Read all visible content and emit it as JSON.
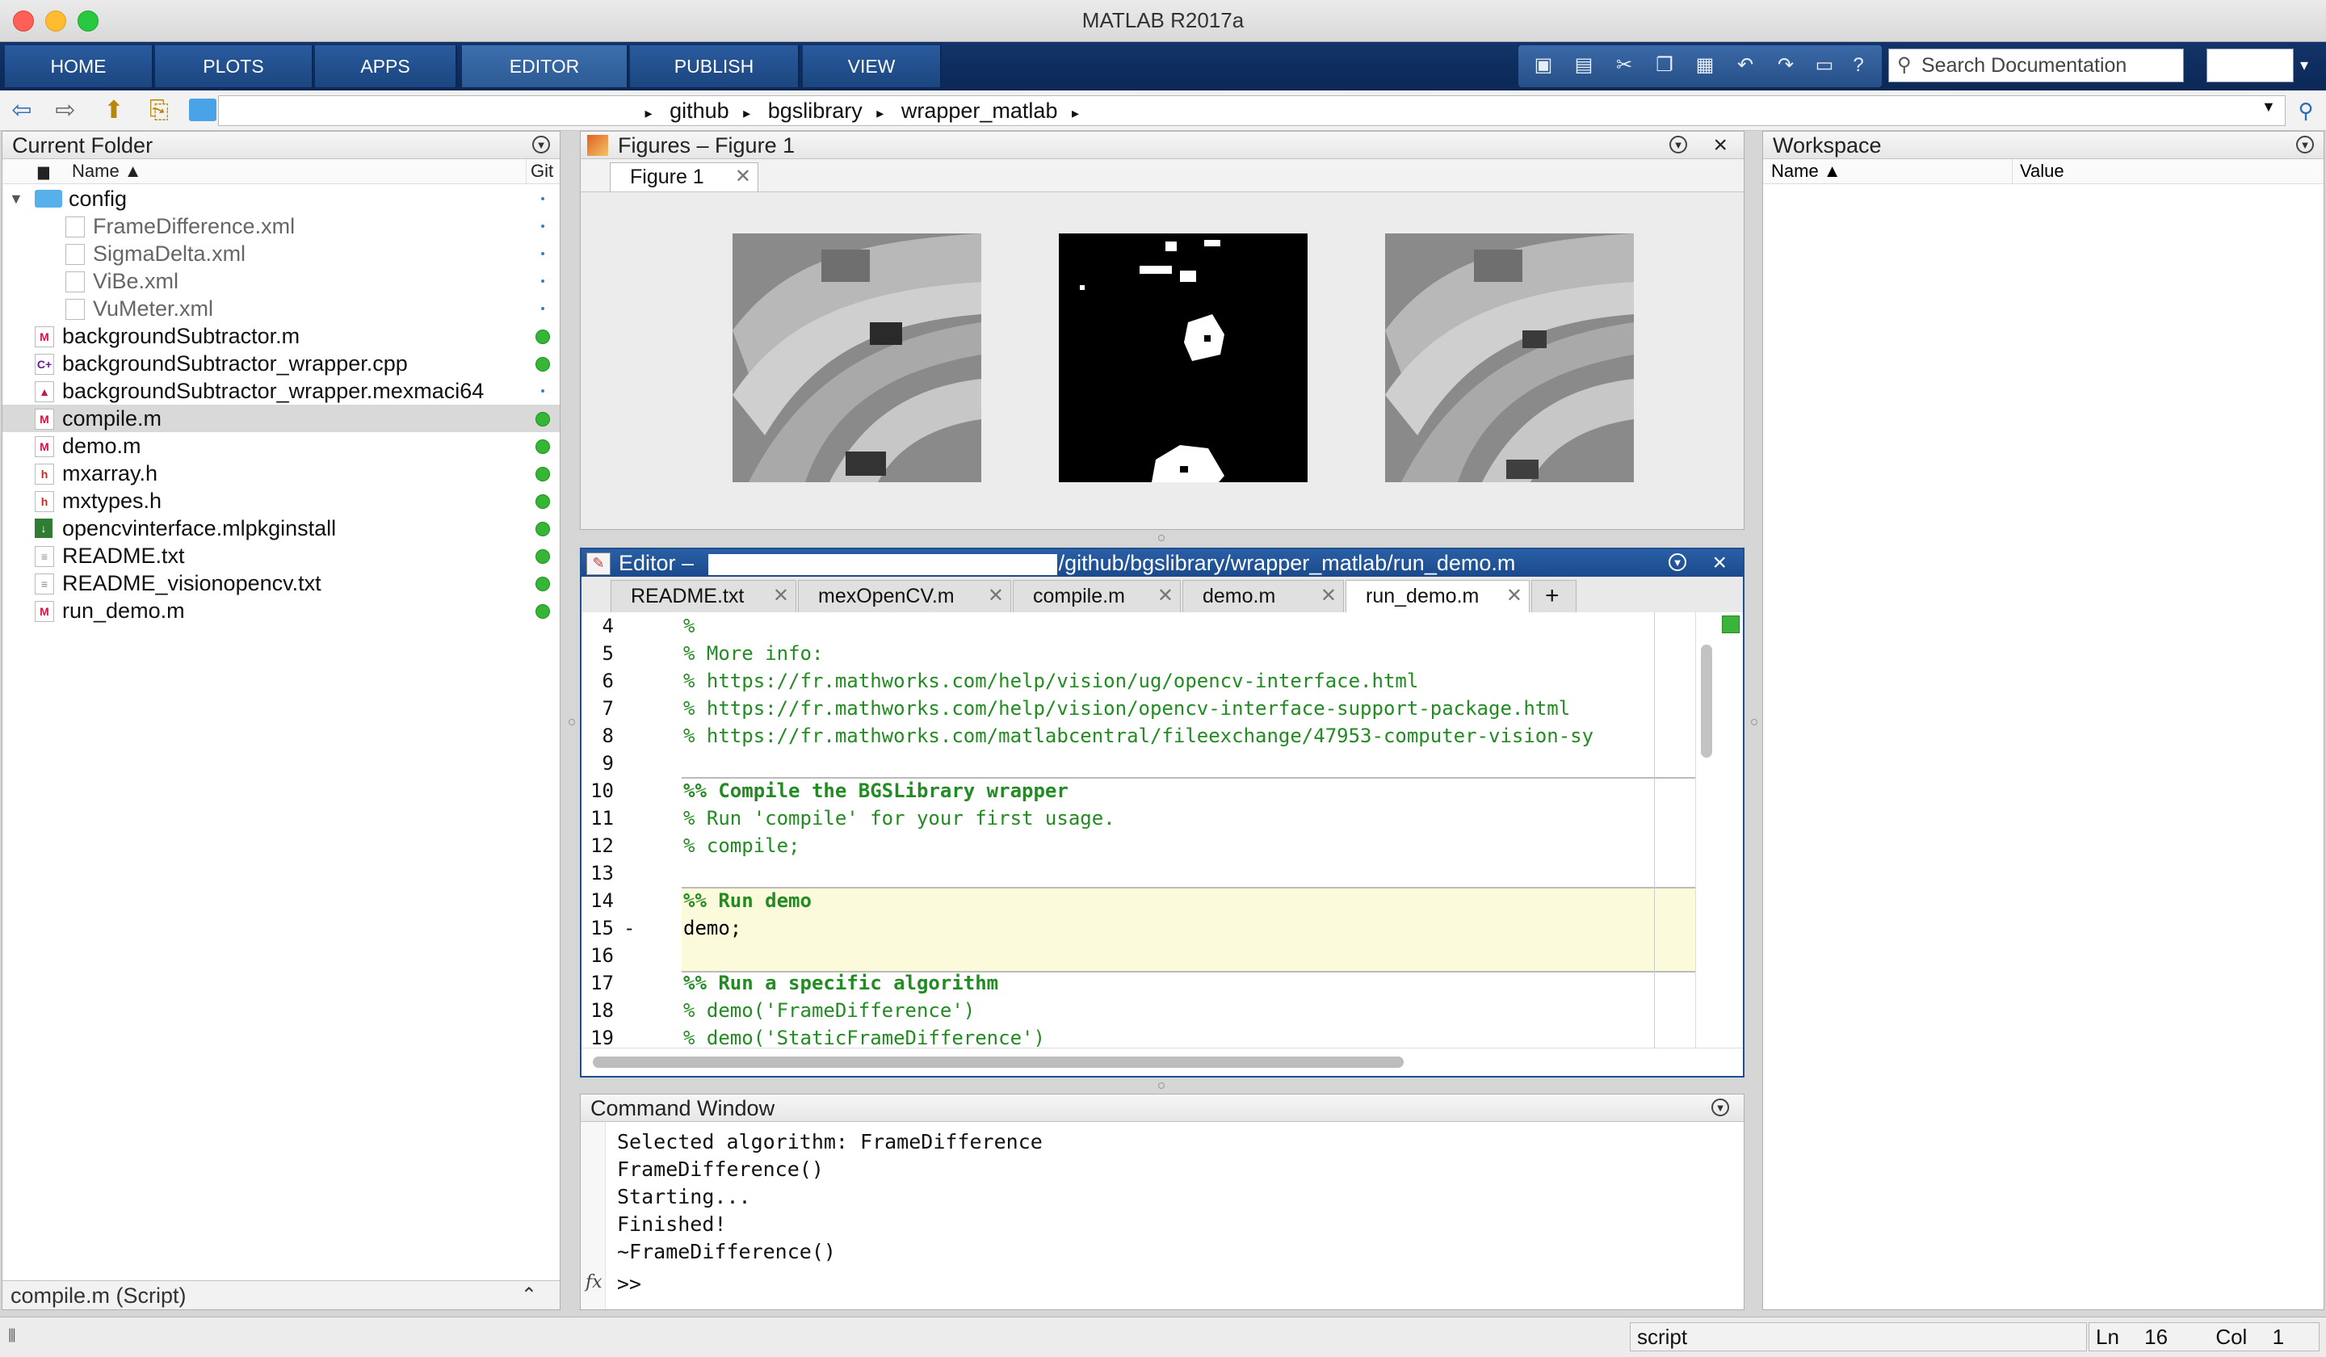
{
  "window": {
    "title": "MATLAB R2017a"
  },
  "toolstrip": {
    "tabs": [
      "HOME",
      "PLOTS",
      "APPS",
      "EDITOR",
      "PUBLISH",
      "VIEW"
    ],
    "active_tab": "EDITOR",
    "search_placeholder": "Search Documentation",
    "quick_access_icons": [
      "new-file-icon",
      "save-icon",
      "cut-icon",
      "copy-icon",
      "paste-icon",
      "undo-icon",
      "redo-icon",
      "switch-windows-icon",
      "help-icon"
    ]
  },
  "address": {
    "sep": "▸",
    "crumbs": [
      "github",
      "bgslibrary",
      "wrapper_matlab"
    ]
  },
  "current_folder": {
    "title": "Current Folder",
    "col_name": "Name ▲",
    "col_git": "Git",
    "items": [
      {
        "name": "config",
        "type": "folder",
        "level": 0
      },
      {
        "name": "FrameDifference.xml",
        "type": "xml",
        "level": 1
      },
      {
        "name": "SigmaDelta.xml",
        "type": "xml",
        "level": 1
      },
      {
        "name": "ViBe.xml",
        "type": "xml",
        "level": 1
      },
      {
        "name": "VuMeter.xml",
        "type": "xml",
        "level": 1
      },
      {
        "name": "backgroundSubtractor.m",
        "type": "m",
        "level": 0
      },
      {
        "name": "backgroundSubtractor_wrapper.cpp",
        "type": "cpp",
        "level": 0
      },
      {
        "name": "backgroundSubtractor_wrapper.mexmaci64",
        "type": "mex",
        "level": 0
      },
      {
        "name": "compile.m",
        "type": "m",
        "level": 0
      },
      {
        "name": "demo.m",
        "type": "m",
        "level": 0
      },
      {
        "name": "mxarray.h",
        "type": "h",
        "level": 0
      },
      {
        "name": "mxtypes.h",
        "type": "h",
        "level": 0
      },
      {
        "name": "opencvinterface.mlpkginstall",
        "type": "pkg",
        "level": 0
      },
      {
        "name": "README.txt",
        "type": "txt",
        "level": 0
      },
      {
        "name": "README_visionopencv.txt",
        "type": "txt",
        "level": 0
      },
      {
        "name": "run_demo.m",
        "type": "m",
        "level": 0
      }
    ],
    "detail": "compile.m  (Script)"
  },
  "figures": {
    "title": "Figures – Figure 1",
    "tab": "Figure 1"
  },
  "editor": {
    "title_prefix": "Editor –",
    "title_path": "/github/bgslibrary/wrapper_matlab/run_demo.m",
    "tabs": [
      "README.txt",
      "mexOpenCV.m",
      "compile.m",
      "demo.m",
      "run_demo.m"
    ],
    "active_tab": "run_demo.m",
    "lines": [
      {
        "n": "4",
        "text": "%",
        "cls": "cmt"
      },
      {
        "n": "5",
        "text": "% More info:",
        "cls": "cmt"
      },
      {
        "n": "6",
        "text": "% https://fr.mathworks.com/help/vision/ug/opencv-interface.html",
        "cls": "cmt"
      },
      {
        "n": "7",
        "text": "% https://fr.mathworks.com/help/vision/opencv-interface-support-package.html",
        "cls": "cmt"
      },
      {
        "n": "8",
        "text": "% https://fr.mathworks.com/matlabcentral/fileexchange/47953-computer-vision-sy",
        "cls": "cmt"
      },
      {
        "n": "9",
        "text": "",
        "cls": ""
      },
      {
        "n": "10",
        "text": "%% Compile the BGSLibrary wrapper",
        "cls": "sec"
      },
      {
        "n": "11",
        "text": "% Run 'compile' for your first usage.",
        "cls": "cmt"
      },
      {
        "n": "12",
        "text": "% compile;",
        "cls": "cmt"
      },
      {
        "n": "13",
        "text": "",
        "cls": ""
      },
      {
        "n": "14",
        "text": "%% Run demo",
        "cls": "sec"
      },
      {
        "n": "15",
        "text": "demo;",
        "cls": ""
      },
      {
        "n": "16",
        "text": "",
        "cls": ""
      },
      {
        "n": "17",
        "text": "%% Run a specific algorithm",
        "cls": "sec"
      },
      {
        "n": "18",
        "text": "% demo('FrameDifference')",
        "cls": "cmt"
      },
      {
        "n": "19",
        "text": "% demo('StaticFrameDifference')",
        "cls": "cmt"
      }
    ]
  },
  "command_window": {
    "title": "Command Window",
    "lines": [
      "Selected algorithm: FrameDifference",
      "FrameDifference()",
      "Starting...",
      "Finished!",
      "~FrameDifference()"
    ],
    "prompt": ">>",
    "fx": "fx"
  },
  "workspace": {
    "title": "Workspace",
    "col_name": "Name ▲",
    "col_value": "Value"
  },
  "status": {
    "mode": "script",
    "ln_label": "Ln",
    "ln": "16",
    "col_label": "Col",
    "col": "1"
  }
}
